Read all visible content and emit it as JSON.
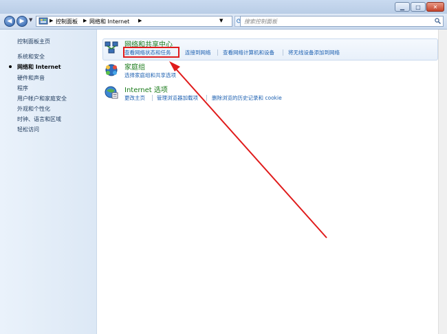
{
  "window": {
    "buttons": {
      "minimize": "▁",
      "maximize": "□",
      "close": "✕"
    }
  },
  "nav": {
    "back_icon": "back-arrow-icon",
    "forward_icon": "forward-arrow-icon",
    "breadcrumb": [
      "控制面板",
      "网络和 Internet"
    ],
    "search_placeholder": "搜索控制面板"
  },
  "sidebar": {
    "home": "控制面板主页",
    "items": [
      {
        "label": "系统和安全",
        "active": false
      },
      {
        "label": "网络和 Internet",
        "active": true
      },
      {
        "label": "硬件和声音",
        "active": false
      },
      {
        "label": "程序",
        "active": false
      },
      {
        "label": "用户帐户和家庭安全",
        "active": false
      },
      {
        "label": "外观和个性化",
        "active": false
      },
      {
        "label": "时钟、语言和区域",
        "active": false
      },
      {
        "label": "轻松访问",
        "active": false
      }
    ]
  },
  "categories": [
    {
      "title": "网络和共享中心",
      "icon": "network-center-icon",
      "links": [
        "查看网络状态和任务",
        "连接到网络",
        "查看网络计算机和设备",
        "将无线设备添加到网络"
      ]
    },
    {
      "title": "家庭组",
      "icon": "homegroup-icon",
      "links": [
        "选择家庭组和共享选项"
      ]
    },
    {
      "title": "Internet 选项",
      "icon": "internet-options-icon",
      "links": [
        "更改主页",
        "管理浏览器加载项",
        "删除浏览的历史记录和 cookie"
      ]
    }
  ],
  "colors": {
    "annotation": "#e01b1b",
    "link": "#1b5fb0",
    "title": "#1a7a1a"
  }
}
